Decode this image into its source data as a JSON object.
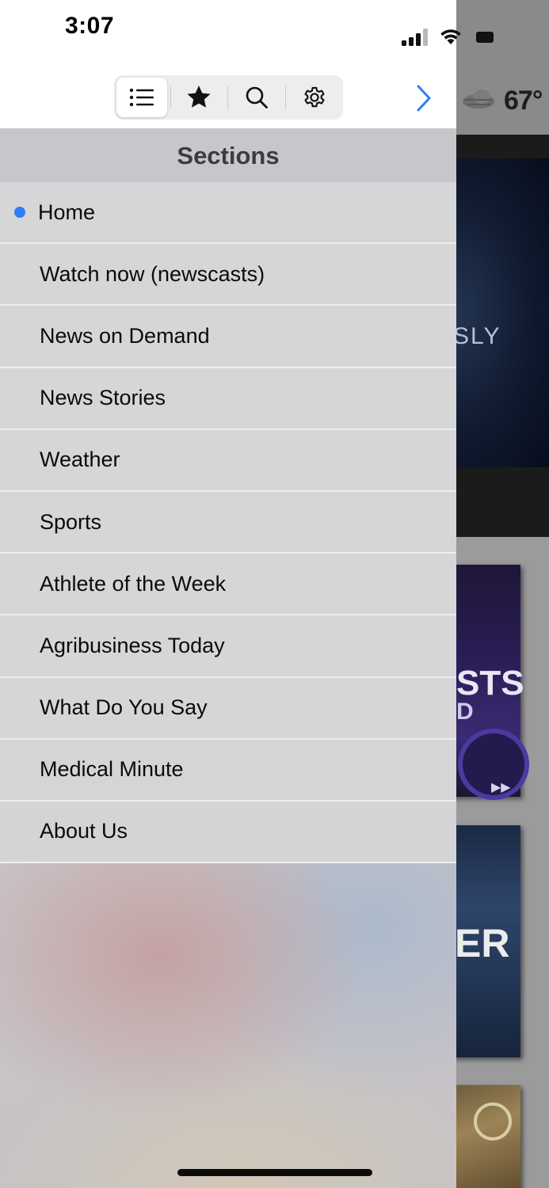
{
  "status_bar": {
    "time": "3:07"
  },
  "toolbar": {
    "tabs": [
      {
        "name": "list-icon",
        "selected": true
      },
      {
        "name": "star-icon",
        "selected": false
      },
      {
        "name": "search-icon",
        "selected": false
      },
      {
        "name": "gear-icon",
        "selected": false
      }
    ],
    "forward_icon": "chevron-right-icon"
  },
  "sections": {
    "header": "Sections",
    "items": [
      {
        "label": "Home",
        "active": true
      },
      {
        "label": "Watch now (newscasts)"
      },
      {
        "label": "News on Demand"
      },
      {
        "label": "News Stories"
      },
      {
        "label": "Weather"
      },
      {
        "label": "Sports"
      },
      {
        "label": "Athlete of the Week"
      },
      {
        "label": "Agribusiness Today"
      },
      {
        "label": "What Do You Say"
      },
      {
        "label": "Medical Minute"
      },
      {
        "label": "About Us"
      }
    ]
  },
  "background_app": {
    "temperature": "67°",
    "video_text": "SLY",
    "card1_line1": "STS",
    "card1_line2": "D",
    "card2_text": "ER"
  },
  "colors": {
    "accent": "#2f7cf6",
    "drawer_bg": "#d6d6d8",
    "header_bg": "#c7c7cb"
  }
}
